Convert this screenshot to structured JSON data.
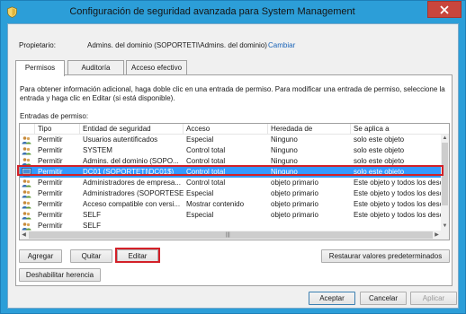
{
  "window": {
    "title": "Configuración de seguridad avanzada para System Management"
  },
  "owner": {
    "label": "Propietario:",
    "value": "Admins. del dominio (SOPORTETI\\Admins. del dominio)",
    "change_link": "Cambiar"
  },
  "tabs": [
    {
      "label": "Permisos",
      "active": true
    },
    {
      "label": "Auditoría",
      "active": false
    },
    {
      "label": "Acceso efectivo",
      "active": false
    }
  ],
  "description": "Para obtener información adicional, haga doble clic en una entrada de permiso. Para modificar una entrada de permiso, seleccione la entrada y haga clic en Editar (si está disponible).",
  "entries_label": "Entradas de permiso:",
  "columns": [
    "Tipo",
    "Entidad de seguridad",
    "Acceso",
    "Heredada de",
    "Se aplica a"
  ],
  "rows": [
    {
      "tipo": "Permitir",
      "entidad": "Usuarios autentificados",
      "acceso": "Especial",
      "heredada": "Ninguno",
      "aplica": "solo este objeto",
      "selected": false
    },
    {
      "tipo": "Permitir",
      "entidad": "SYSTEM",
      "acceso": "Control total",
      "heredada": "Ninguno",
      "aplica": "solo este objeto",
      "selected": false
    },
    {
      "tipo": "Permitir",
      "entidad": "Admins. del dominio (SOPO...",
      "acceso": "Control total",
      "heredada": "Ninguno",
      "aplica": "solo este objeto",
      "selected": false
    },
    {
      "tipo": "Permitir",
      "entidad": "DC01 (SOPORTETI\\DC01$)",
      "acceso": "Control total",
      "heredada": "Ninguno",
      "aplica": "solo este objeto",
      "selected": true
    },
    {
      "tipo": "Permitir",
      "entidad": "Administradores de empresa...",
      "acceso": "Control total",
      "heredada": "objeto primario",
      "aplica": "Este objeto y todos los desc",
      "selected": false
    },
    {
      "tipo": "Permitir",
      "entidad": "Administradores (SOPORTESE...",
      "acceso": "Especial",
      "heredada": "objeto primario",
      "aplica": "Este objeto y todos los desc",
      "selected": false
    },
    {
      "tipo": "Permitir",
      "entidad": "Acceso compatible con versi...",
      "acceso": "Mostrar contenido",
      "heredada": "objeto primario",
      "aplica": "Este objeto y todos los desc",
      "selected": false
    },
    {
      "tipo": "Permitir",
      "entidad": "SELF",
      "acceso": "Especial",
      "heredada": "objeto primario",
      "aplica": "Este objeto y todos los desc",
      "selected": false
    },
    {
      "tipo": "Permitir",
      "entidad": "SELF",
      "acceso": "",
      "heredada": "",
      "aplica": "",
      "selected": false
    }
  ],
  "buttons": {
    "add": "Agregar",
    "remove": "Quitar",
    "edit": "Editar",
    "restore": "Restaurar valores predeterminados",
    "disable_inheritance": "Deshabilitar herencia",
    "ok": "Aceptar",
    "cancel": "Cancelar",
    "apply": "Aplicar"
  },
  "colors": {
    "titlebar": "#2c9ed8",
    "close": "#c9463d",
    "selection": "#3399ff",
    "highlight_outline": "#d32028",
    "link": "#1a64b8"
  },
  "icons": {
    "title": "security-shield-icon",
    "row": "users-group-icon",
    "row_selected": "computer-icon",
    "close": "close-icon"
  }
}
